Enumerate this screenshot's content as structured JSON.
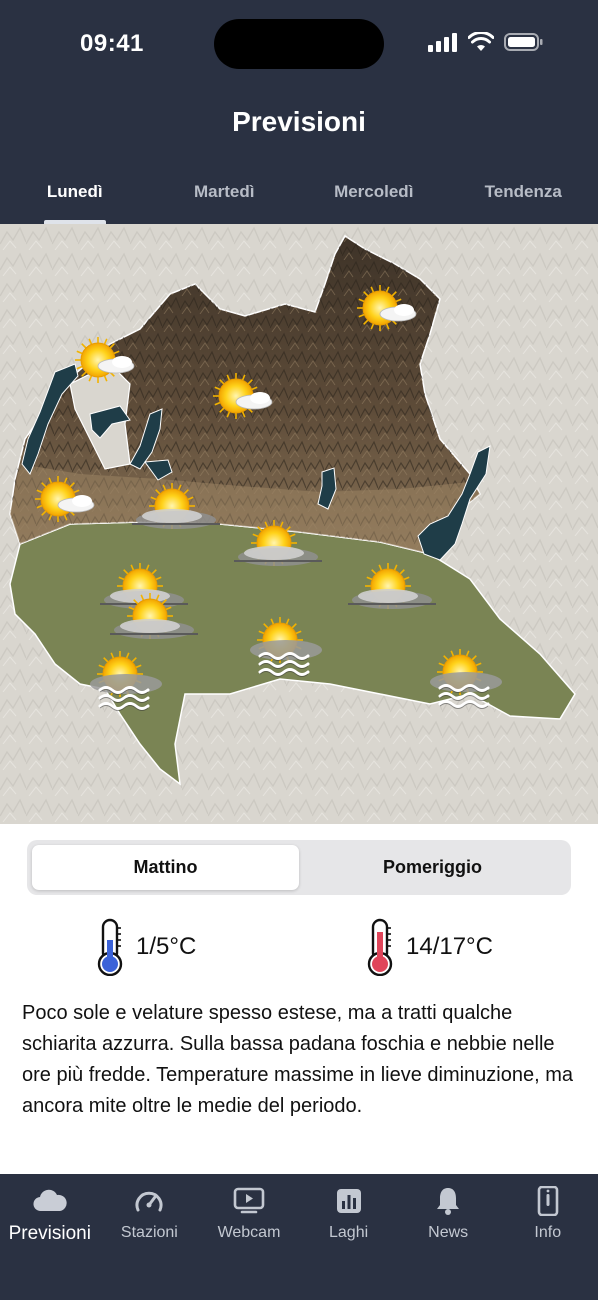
{
  "status_bar": {
    "time": "09:41"
  },
  "header": {
    "title": "Previsioni",
    "tabs": [
      {
        "label": "Lunedì",
        "active": true
      },
      {
        "label": "Martedì",
        "active": false
      },
      {
        "label": "Mercoledì",
        "active": false
      },
      {
        "label": "Tendenza",
        "active": false
      }
    ]
  },
  "map": {
    "icons": [
      "sun-cloud-icon",
      "sun-cloud-icon",
      "sun-cloud-icon",
      "sun-cloud-icon",
      "sun-veiled-icon",
      "sun-veiled-icon",
      "sun-veiled-icon",
      "sun-veiled-icon",
      "sun-veiled-icon",
      "sun-fog-icon",
      "sun-fog-icon",
      "sun-fog-icon"
    ]
  },
  "segment": {
    "options": [
      {
        "label": "Mattino",
        "active": true
      },
      {
        "label": "Pomeriggio",
        "active": false
      }
    ]
  },
  "temperatures": {
    "min": {
      "value": "1/5°C",
      "icon": "thermometer-cold-icon",
      "color": "#3b62d8"
    },
    "max": {
      "value": "14/17°C",
      "icon": "thermometer-warm-icon",
      "color": "#e0455a"
    }
  },
  "description": "Poco sole e velature spesso estese, ma a tratti qualche schiarita azzurra. Sulla bassa padana foschia e nebbie nelle ore più fredde. Temperature massime in lieve diminuzione, ma ancora mite oltre le medie del periodo.",
  "tabbar": {
    "items": [
      {
        "label": "Previsioni",
        "icon": "cloud-icon",
        "active": true
      },
      {
        "label": "Stazioni",
        "icon": "gauge-icon",
        "active": false
      },
      {
        "label": "Webcam",
        "icon": "tv-icon",
        "active": false
      },
      {
        "label": "Laghi",
        "icon": "chart-icon",
        "active": false
      },
      {
        "label": "News",
        "icon": "bell-icon",
        "active": false
      },
      {
        "label": "Info",
        "icon": "phone-icon",
        "active": false
      }
    ]
  },
  "colors": {
    "header_bg": "#2a3142",
    "plain_green": "#7a8454",
    "mountains_brown": "#5a4a38",
    "lakes": "#1f3d48"
  }
}
